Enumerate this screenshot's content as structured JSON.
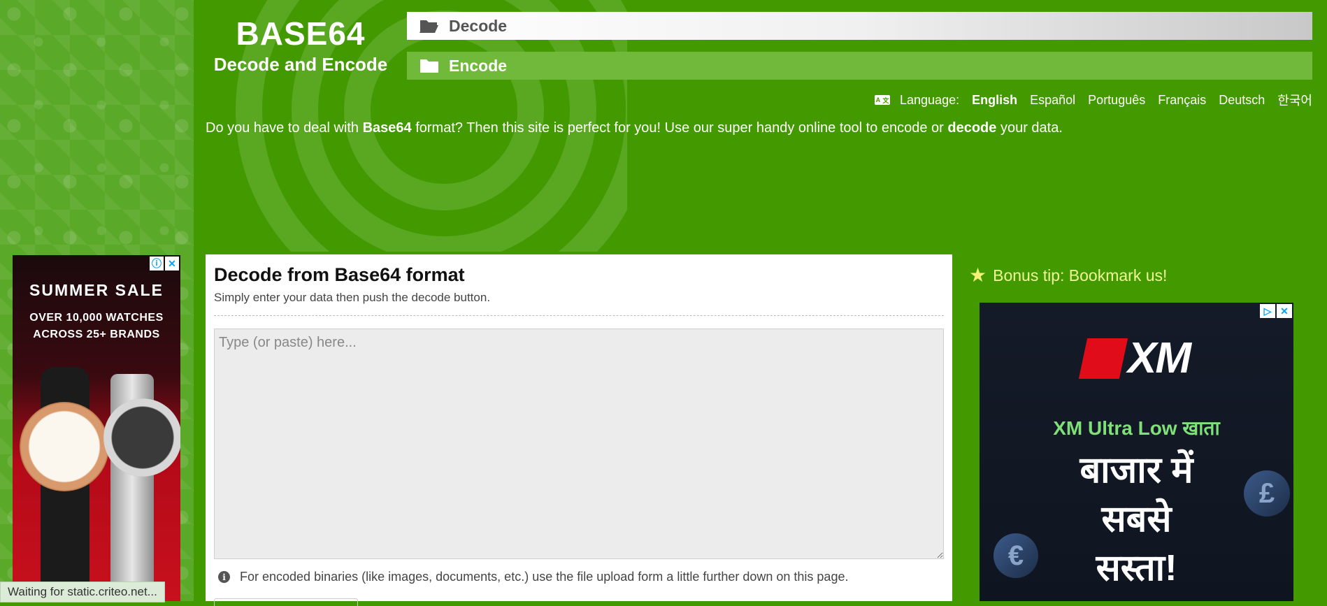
{
  "logo": {
    "title": "BASE64",
    "subtitle": "Decode and Encode"
  },
  "nav": {
    "decode_label": "Decode",
    "encode_label": "Encode"
  },
  "language": {
    "label": "Language:",
    "options": [
      "English",
      "Español",
      "Português",
      "Français",
      "Deutsch",
      "한국어"
    ],
    "selected": "English"
  },
  "intro": {
    "part1": "Do you have to deal with ",
    "bold1": "Base64",
    "part2": " format? Then this site is perfect for you! Use our super handy online tool to encode or ",
    "bold2": "decode",
    "part3": " your data."
  },
  "panel": {
    "title": "Decode from Base64 format",
    "subtitle": "Simply enter your data then push the decode button.",
    "textarea_placeholder": "Type (or paste) here...",
    "note": "For encoded binaries (like images, documents, etc.) use the file upload form a little further down on this page."
  },
  "bonus": {
    "text": "Bonus tip: Bookmark us!"
  },
  "ad_left": {
    "headline": "SUMMER SALE",
    "line1": "OVER 10,000 WATCHES",
    "line2": "ACROSS 25+ BRANDS",
    "info_icon": "info-icon",
    "close_icon": "close-icon"
  },
  "ad_right": {
    "brand": "XM",
    "line1": "XM Ultra Low खाता",
    "big1": "बाजार में",
    "big2": "सबसे",
    "big3": "सस्ता!",
    "adchoices_icon": "adchoices-icon",
    "close_icon": "close-icon"
  },
  "status": {
    "text": "Waiting for static.criteo.net..."
  },
  "colors": {
    "page_bg": "#429a00",
    "encode_bar": "#70b93a",
    "bonus_text": "#eef99a"
  }
}
